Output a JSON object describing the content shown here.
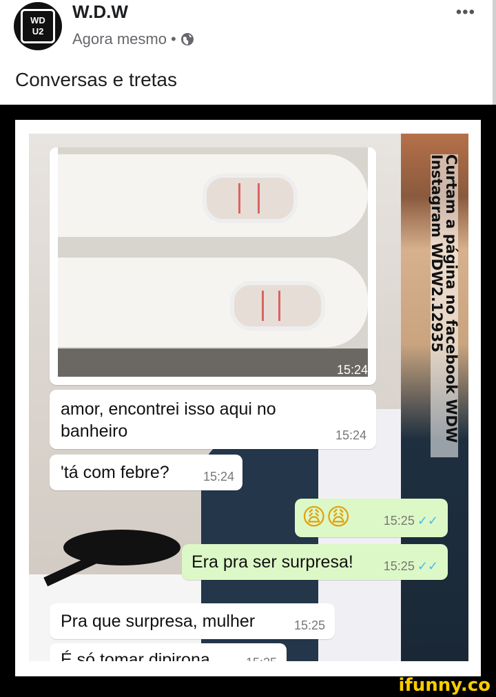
{
  "post": {
    "page_name": "W.D.W",
    "timestamp": "Agora mesmo",
    "separator": "•",
    "privacy_icon": "globe-icon",
    "more_icon": "more-options-icon",
    "more_glyph": "•••",
    "caption": "Conversas e tretas",
    "avatar_logo": {
      "line1": "WD",
      "line2": "U2"
    }
  },
  "chat": {
    "image_timestamp": "15:24",
    "messages": [
      {
        "direction": "in",
        "text_line1": "amor, encontrei isso aqui no",
        "text_line2": "banheiro",
        "time": "15:24"
      },
      {
        "direction": "in",
        "text": "'tá com febre?",
        "time": "15:24"
      },
      {
        "direction": "out",
        "text": "😩😩",
        "time": "15:25",
        "ticks": "✓✓"
      },
      {
        "direction": "out",
        "text": "Era pra ser surpresa!",
        "time": "15:25",
        "ticks": "✓✓"
      },
      {
        "direction": "in",
        "text": "Pra que surpresa, mulher",
        "time": "15:25"
      },
      {
        "direction": "in",
        "text": "É só tomar dipirona",
        "time": "15:25"
      }
    ]
  },
  "watermark": {
    "line1": "Curtam a página no facebook WDW",
    "line2": "Instagram WDW2.12935"
  },
  "footer": {
    "brand": "ifunny.co"
  },
  "colors": {
    "incoming": "#ffffff",
    "outgoing": "#dcf8c6",
    "ticks": "#4fb6ec",
    "brand": "#ffcc00"
  }
}
